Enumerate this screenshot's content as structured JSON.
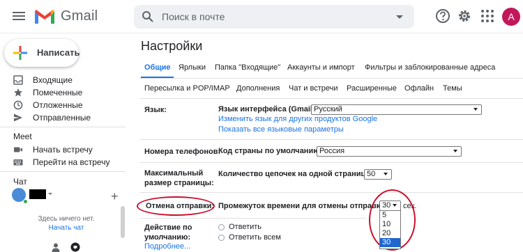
{
  "header": {
    "brand": "Gmail",
    "search_placeholder": "Поиск в почте",
    "avatar_letter": "A",
    "colors": {
      "accent": "#1a73e8",
      "avatar": "#c2185b",
      "highlight_ring": "#c8102e"
    }
  },
  "sidebar": {
    "compose_label": "Написать",
    "folders": [
      {
        "label": "Входящие",
        "icon": "inbox-icon"
      },
      {
        "label": "Помеченные",
        "icon": "star-icon"
      },
      {
        "label": "Отложенные",
        "icon": "clock-icon"
      },
      {
        "label": "Отправленные",
        "icon": "send-icon"
      }
    ],
    "meet": {
      "title": "Meet",
      "items": [
        {
          "label": "Начать встречу",
          "icon": "video-icon"
        },
        {
          "label": "Перейти на встречу",
          "icon": "keyboard-icon"
        }
      ]
    },
    "chat": {
      "title": "Чат",
      "empty_text": "Здесь ничего нет.",
      "start_link": "Начать чат"
    }
  },
  "settings": {
    "title": "Настройки",
    "tabs_row1": [
      "Общие",
      "Ярлыки",
      "Папка \"Входящие\"",
      "Аккаунты и импорт",
      "Фильтры и заблокированные адреса"
    ],
    "tabs_row2": [
      "Пересылка и POP/IMAP",
      "Дополнения",
      "Чат и встречи",
      "Расширенные",
      "Офлайн",
      "Темы"
    ],
    "language": {
      "label": "Язык:",
      "field_label": "Язык интерфейса (Gmail):",
      "value": "Русский",
      "link1": "Изменить язык для других продуктов Google",
      "link2": "Показать все языковые параметры"
    },
    "phone": {
      "label": "Номера телефонов:",
      "field_label": "Код страны по умолчанию:",
      "value": "Россия"
    },
    "page_size": {
      "label_line1": "Максимальный",
      "label_line2": "размер страницы:",
      "field_label": "Количество цепочек на одной странице:",
      "value": "50"
    },
    "undo_send": {
      "label": "Отмена отправки:",
      "field_label": "Промежуток времени для отмены отправки:",
      "value": "30",
      "unit": "сек.",
      "options": [
        "5",
        "10",
        "20",
        "30"
      ],
      "selected": "30"
    },
    "reply_default": {
      "label_line1": "Действие по",
      "label_line2": "умолчанию:",
      "more_link": "Подробнее...",
      "options": [
        "Ответить",
        "Ответить всем"
      ]
    }
  }
}
